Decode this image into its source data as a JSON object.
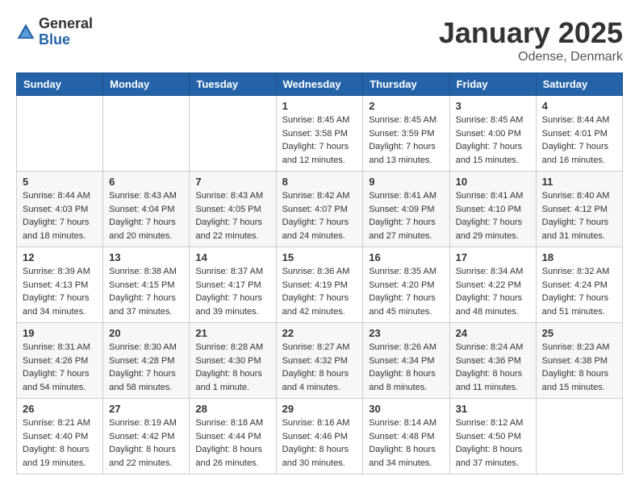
{
  "logo": {
    "general": "General",
    "blue": "Blue"
  },
  "title": "January 2025",
  "location": "Odense, Denmark",
  "days": [
    "Sunday",
    "Monday",
    "Tuesday",
    "Wednesday",
    "Thursday",
    "Friday",
    "Saturday"
  ],
  "weeks": [
    [
      {
        "day": "",
        "content": ""
      },
      {
        "day": "",
        "content": ""
      },
      {
        "day": "",
        "content": ""
      },
      {
        "day": "1",
        "content": "Sunrise: 8:45 AM\nSunset: 3:58 PM\nDaylight: 7 hours\nand 12 minutes."
      },
      {
        "day": "2",
        "content": "Sunrise: 8:45 AM\nSunset: 3:59 PM\nDaylight: 7 hours\nand 13 minutes."
      },
      {
        "day": "3",
        "content": "Sunrise: 8:45 AM\nSunset: 4:00 PM\nDaylight: 7 hours\nand 15 minutes."
      },
      {
        "day": "4",
        "content": "Sunrise: 8:44 AM\nSunset: 4:01 PM\nDaylight: 7 hours\nand 16 minutes."
      }
    ],
    [
      {
        "day": "5",
        "content": "Sunrise: 8:44 AM\nSunset: 4:03 PM\nDaylight: 7 hours\nand 18 minutes."
      },
      {
        "day": "6",
        "content": "Sunrise: 8:43 AM\nSunset: 4:04 PM\nDaylight: 7 hours\nand 20 minutes."
      },
      {
        "day": "7",
        "content": "Sunrise: 8:43 AM\nSunset: 4:05 PM\nDaylight: 7 hours\nand 22 minutes."
      },
      {
        "day": "8",
        "content": "Sunrise: 8:42 AM\nSunset: 4:07 PM\nDaylight: 7 hours\nand 24 minutes."
      },
      {
        "day": "9",
        "content": "Sunrise: 8:41 AM\nSunset: 4:09 PM\nDaylight: 7 hours\nand 27 minutes."
      },
      {
        "day": "10",
        "content": "Sunrise: 8:41 AM\nSunset: 4:10 PM\nDaylight: 7 hours\nand 29 minutes."
      },
      {
        "day": "11",
        "content": "Sunrise: 8:40 AM\nSunset: 4:12 PM\nDaylight: 7 hours\nand 31 minutes."
      }
    ],
    [
      {
        "day": "12",
        "content": "Sunrise: 8:39 AM\nSunset: 4:13 PM\nDaylight: 7 hours\nand 34 minutes."
      },
      {
        "day": "13",
        "content": "Sunrise: 8:38 AM\nSunset: 4:15 PM\nDaylight: 7 hours\nand 37 minutes."
      },
      {
        "day": "14",
        "content": "Sunrise: 8:37 AM\nSunset: 4:17 PM\nDaylight: 7 hours\nand 39 minutes."
      },
      {
        "day": "15",
        "content": "Sunrise: 8:36 AM\nSunset: 4:19 PM\nDaylight: 7 hours\nand 42 minutes."
      },
      {
        "day": "16",
        "content": "Sunrise: 8:35 AM\nSunset: 4:20 PM\nDaylight: 7 hours\nand 45 minutes."
      },
      {
        "day": "17",
        "content": "Sunrise: 8:34 AM\nSunset: 4:22 PM\nDaylight: 7 hours\nand 48 minutes."
      },
      {
        "day": "18",
        "content": "Sunrise: 8:32 AM\nSunset: 4:24 PM\nDaylight: 7 hours\nand 51 minutes."
      }
    ],
    [
      {
        "day": "19",
        "content": "Sunrise: 8:31 AM\nSunset: 4:26 PM\nDaylight: 7 hours\nand 54 minutes."
      },
      {
        "day": "20",
        "content": "Sunrise: 8:30 AM\nSunset: 4:28 PM\nDaylight: 7 hours\nand 58 minutes."
      },
      {
        "day": "21",
        "content": "Sunrise: 8:28 AM\nSunset: 4:30 PM\nDaylight: 8 hours\nand 1 minute."
      },
      {
        "day": "22",
        "content": "Sunrise: 8:27 AM\nSunset: 4:32 PM\nDaylight: 8 hours\nand 4 minutes."
      },
      {
        "day": "23",
        "content": "Sunrise: 8:26 AM\nSunset: 4:34 PM\nDaylight: 8 hours\nand 8 minutes."
      },
      {
        "day": "24",
        "content": "Sunrise: 8:24 AM\nSunset: 4:36 PM\nDaylight: 8 hours\nand 11 minutes."
      },
      {
        "day": "25",
        "content": "Sunrise: 8:23 AM\nSunset: 4:38 PM\nDaylight: 8 hours\nand 15 minutes."
      }
    ],
    [
      {
        "day": "26",
        "content": "Sunrise: 8:21 AM\nSunset: 4:40 PM\nDaylight: 8 hours\nand 19 minutes."
      },
      {
        "day": "27",
        "content": "Sunrise: 8:19 AM\nSunset: 4:42 PM\nDaylight: 8 hours\nand 22 minutes."
      },
      {
        "day": "28",
        "content": "Sunrise: 8:18 AM\nSunset: 4:44 PM\nDaylight: 8 hours\nand 26 minutes."
      },
      {
        "day": "29",
        "content": "Sunrise: 8:16 AM\nSunset: 4:46 PM\nDaylight: 8 hours\nand 30 minutes."
      },
      {
        "day": "30",
        "content": "Sunrise: 8:14 AM\nSunset: 4:48 PM\nDaylight: 8 hours\nand 34 minutes."
      },
      {
        "day": "31",
        "content": "Sunrise: 8:12 AM\nSunset: 4:50 PM\nDaylight: 8 hours\nand 37 minutes."
      },
      {
        "day": "",
        "content": ""
      }
    ]
  ]
}
